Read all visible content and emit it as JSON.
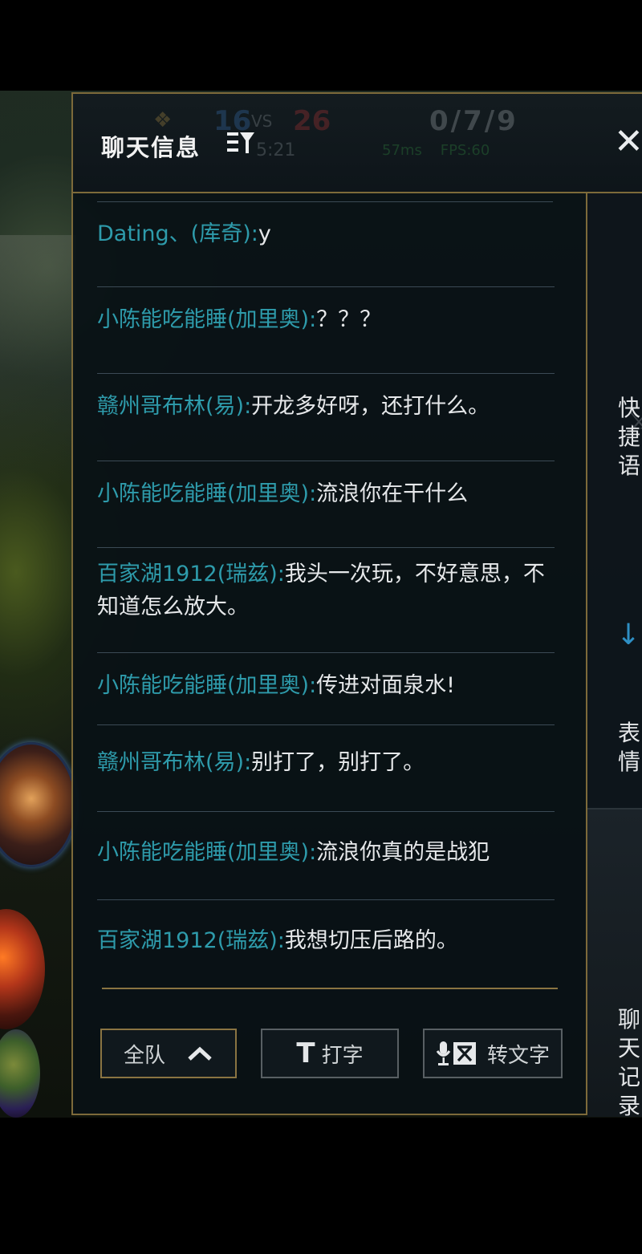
{
  "header": {
    "title": "聊天信息",
    "filter_icon": "filter-icon",
    "close_label": "✕"
  },
  "hud": {
    "blue_score": "16",
    "vs": "VS",
    "red_score": "26",
    "kda": "0/7/9",
    "timer": "5:21",
    "network": "57ms",
    "fps": "FPS:60"
  },
  "messages": [
    {
      "sender": "Dating、(库奇):",
      "text": "y"
    },
    {
      "sender": "小陈能吃能睡(加里奥):",
      "text": "？？？"
    },
    {
      "sender": "赣州哥布林(易):",
      "text": "开龙多好呀，还打什么。"
    },
    {
      "sender": "小陈能吃能睡(加里奥):",
      "text": "流浪你在干什么"
    },
    {
      "sender": "百家湖1912(瑞兹):",
      "text": "我头一次玩，不好意思，不知道怎么放大。"
    },
    {
      "sender": "小陈能吃能睡(加里奥):",
      "text": "传进对面泉水!"
    },
    {
      "sender": "赣州哥布林(易):",
      "text": "别打了，别打了。"
    },
    {
      "sender": "小陈能吃能睡(加里奥):",
      "text": "流浪你真的是战犯"
    },
    {
      "sender": "百家湖1912(瑞兹):",
      "text": "我想切压后路的。"
    }
  ],
  "buttons": {
    "team_label": "全队",
    "team_icon": "chevron-up-icon",
    "type_glyph": "T",
    "type_label": "打字",
    "voice_icon": "voice-to-text-icon",
    "voice_label": "转文字"
  },
  "sidebar": {
    "quick_phrases": "快捷语",
    "emoji": "表情",
    "history": "聊天记录"
  },
  "colors": {
    "accent_gold": "#7d6a3a",
    "sender_cyan": "#2e9bab",
    "message_text": "#e6e8ea"
  }
}
